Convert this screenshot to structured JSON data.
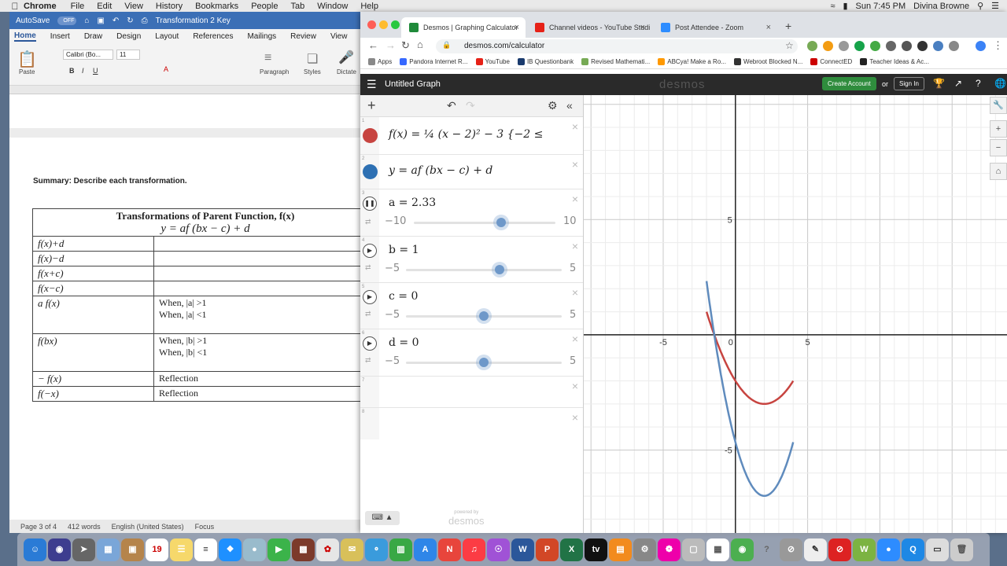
{
  "menubar": {
    "app": "Chrome",
    "menus": [
      "File",
      "Edit",
      "View",
      "History",
      "Bookmarks",
      "People",
      "Tab",
      "Window",
      "Help"
    ],
    "clock": "Sun 7:45 PM",
    "user": "Divina Browne"
  },
  "word": {
    "autosave": "AutoSave",
    "autosave_state": "OFF",
    "doc_title": "Transformation 2 Key",
    "tabs": [
      "Home",
      "Insert",
      "Draw",
      "Design",
      "Layout",
      "References",
      "Mailings",
      "Review",
      "View"
    ],
    "font_name": "Calibri (Bo...",
    "font_size": "11",
    "paste_label": "Paste",
    "paragraph_label": "Paragraph",
    "styles_label": "Styles",
    "dictate_label": "Dictate",
    "summary": "Summary: Describe each transformation.",
    "table": {
      "title": "Transformations of Parent Function, f(x)",
      "subtitle": "y = af (bx − c) + d",
      "rows": [
        {
          "func": "f(x)+d",
          "desc": ""
        },
        {
          "func": "f(x)−d",
          "desc": ""
        },
        {
          "func": "f(x+c)",
          "desc": ""
        },
        {
          "func": "f(x−c)",
          "desc": ""
        },
        {
          "func": "a f(x)",
          "desc": "When, |a| >1\nWhen, |a| <1"
        },
        {
          "func": "f(bx)",
          "desc": "When, |b| >1\nWhen, |b| <1"
        },
        {
          "func": "− f(x)",
          "desc": "Reflection"
        },
        {
          "func": "f(−x)",
          "desc": "Reflection"
        }
      ]
    },
    "status": {
      "page": "Page 3 of 4",
      "words": "412 words",
      "language": "English (United States)",
      "focus": "Focus"
    }
  },
  "chrome": {
    "tabs": [
      {
        "title": "Desmos | Graphing Calculator",
        "color": "#1f8a3a"
      },
      {
        "title": "Channel videos - YouTube Studi",
        "color": "#e62117"
      },
      {
        "title": "Post Attendee - Zoom",
        "color": "#2d8cff"
      }
    ],
    "url": "desmos.com/calculator",
    "bookmarks": [
      {
        "label": "Apps",
        "color": "#888"
      },
      {
        "label": "Pandora Internet R...",
        "color": "#3668ff"
      },
      {
        "label": "YouTube",
        "color": "#e62117"
      },
      {
        "label": "IB Questionbank",
        "color": "#1a3b6e"
      },
      {
        "label": "Revised Mathemati...",
        "color": "#7a5"
      },
      {
        "label": "ABCya! Make a Ro...",
        "color": "#f90"
      },
      {
        "label": "Webroot Blocked N...",
        "color": "#333"
      },
      {
        "label": "ConnectED",
        "color": "#c00"
      },
      {
        "label": "Teacher Ideas & Ac...",
        "color": "#222"
      }
    ]
  },
  "desmos": {
    "graph_title": "Untitled Graph",
    "logo": "desmos",
    "create_account": "Create Account",
    "or": "or",
    "sign_in": "Sign In",
    "expressions": [
      {
        "latex": "f(x) = ¼ (x − 2)² − 3 {−2 ≤",
        "color": "#c74440"
      },
      {
        "latex": "y = af (bx − c) + d",
        "color": "#2d70b3"
      }
    ],
    "sliders": [
      {
        "label": "a = 2.33",
        "min": "−10",
        "max": "10",
        "value": 2.33,
        "lo": -10,
        "hi": 10,
        "playing": true
      },
      {
        "label": "b = 1",
        "min": "−5",
        "max": "5",
        "value": 1,
        "lo": -5,
        "hi": 5,
        "playing": false
      },
      {
        "label": "c = 0",
        "min": "−5",
        "max": "5",
        "value": 0,
        "lo": -5,
        "hi": 5,
        "playing": false
      },
      {
        "label": "d = 0",
        "min": "−5",
        "max": "5",
        "value": 0,
        "lo": -5,
        "hi": 5,
        "playing": false
      }
    ],
    "powered_by": "powered by",
    "powered_logo": "desmos",
    "graph": {
      "xlim": [
        -10.5,
        18.8
      ],
      "ylim": [
        -8.6,
        10.4
      ],
      "ticks": {
        "x": [
          "-5",
          "0",
          "5"
        ],
        "y": [
          "5",
          "-5"
        ]
      },
      "curve_red": {
        "color": "#c74440",
        "xmin": -2,
        "xmax": 4
      },
      "curve_blue": {
        "color": "#5f8bbd",
        "xmin": -2,
        "xmax": 4
      }
    }
  }
}
